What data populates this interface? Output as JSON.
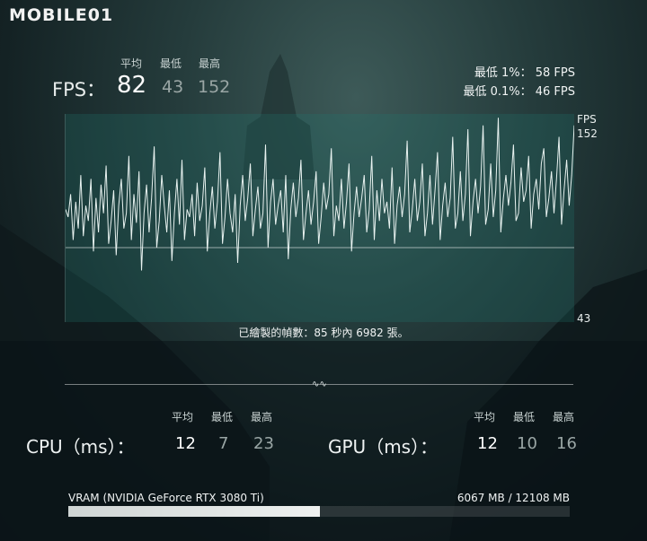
{
  "brand": {
    "logo": "MOBILE01"
  },
  "fps": {
    "label": "FPS：",
    "headers": {
      "avg": "平均",
      "min": "最低",
      "max": "最高"
    },
    "avg": "82",
    "min": "43",
    "max": "152",
    "low_1": "最低 1%： 58 FPS",
    "low_01": "最低 0.1%： 46 FPS"
  },
  "graph": {
    "axis_unit": "FPS",
    "axis_max_label": "152",
    "axis_min_label": "43",
    "frames_note": "已繪製的幀數：85 秒內 6982 張。"
  },
  "chart_data": {
    "type": "line",
    "ylim": [
      43,
      152
    ],
    "reference_line": 82,
    "series": [
      {
        "values": [
          102,
          98,
          110,
          86,
          106,
          92,
          120,
          88,
          104,
          96,
          118,
          80,
          108,
          90,
          115,
          100,
          125,
          84,
          96,
          112,
          78,
          104,
          118,
          92,
          100,
          130,
          86,
          110,
          95,
          122,
          70,
          100,
          115,
          90,
          108,
          135,
          82,
          96,
          120,
          104,
          90,
          112,
          75,
          100,
          118,
          94,
          128,
          86,
          102,
          98,
          110,
          88,
          116,
          96,
          104,
          124,
          80,
          100,
          114,
          92,
          106,
          132,
          84,
          98,
          118,
          100,
          90,
          110,
          74,
          104,
          120,
          96,
          108,
          126,
          88,
          102,
          114,
          92,
          100,
          136,
          82,
          106,
          118,
          94,
          104,
          112,
          90,
          120,
          76,
          102,
          116,
          98,
          108,
          128,
          86,
          100,
          112,
          94,
          106,
          122,
          84,
          98,
          116,
          102,
          110,
          134,
          88,
          104,
          96,
          118,
          92,
          106,
          126,
          80,
          100,
          114,
          98,
          108,
          120,
          90,
          102,
          130,
          86,
          112,
          96,
          118,
          100,
          106,
          92,
          124,
          84,
          104,
          114,
          98,
          110,
          138,
          90,
          102,
          118,
          96,
          106,
          126,
          88,
          100,
          120,
          94,
          112,
          132,
          86,
          104,
          116,
          98,
          108,
          140,
          92,
          100,
          122,
          96,
          110,
          144,
          88,
          106,
          118,
          100,
          114,
          146,
          94,
          102,
          126,
          98,
          112,
          150,
          90,
          108,
          120,
          104,
          116,
          136,
          96,
          100,
          124,
          106,
          112,
          130,
          92,
          110,
          118,
          102,
          126,
          134,
          98,
          108,
          122,
          100,
          118,
          140,
          94,
          112,
          128,
          104,
          120,
          146
        ]
      }
    ]
  },
  "cpu": {
    "label": "CPU（ms）：",
    "headers": {
      "avg": "平均",
      "min": "最低",
      "max": "最高"
    },
    "avg": "12",
    "min": "7",
    "max": "23"
  },
  "gpu": {
    "label": "GPU（ms）：",
    "headers": {
      "avg": "平均",
      "min": "最低",
      "max": "最高"
    },
    "avg": "12",
    "min": "10",
    "max": "16"
  },
  "vram": {
    "label": "VRAM (NVIDIA GeForce RTX 3080 Ti)",
    "value": "6067 MB / 12108 MB",
    "used": 6067,
    "total": 12108
  }
}
